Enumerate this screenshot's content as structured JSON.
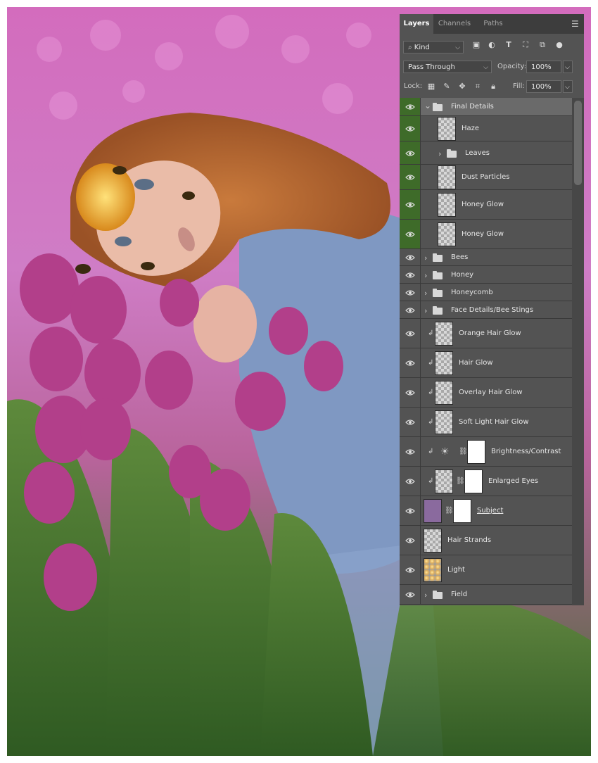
{
  "panel": {
    "tabs": [
      "Layers",
      "Channels",
      "Paths"
    ],
    "filter_kind": "Kind",
    "blend_mode": "Pass Through",
    "opacity_label": "Opacity:",
    "opacity_value": "100%",
    "lock_label": "Lock:",
    "fill_label": "Fill:",
    "fill_value": "100%"
  },
  "layers": [
    {
      "name": "Final Details",
      "kind": "group",
      "expanded": true,
      "selected": true,
      "green": true
    },
    {
      "name": "Haze",
      "kind": "pixel",
      "indent": true,
      "green": true
    },
    {
      "name": "Leaves",
      "kind": "group",
      "indent": true,
      "green": true
    },
    {
      "name": "Dust Particles",
      "kind": "pixel",
      "indent": true,
      "green": true
    },
    {
      "name": "Honey Glow",
      "kind": "pixel",
      "indent": true,
      "green": true
    },
    {
      "name": "Honey Glow",
      "kind": "pixel",
      "indent": true,
      "green": true
    },
    {
      "name": "Bees",
      "kind": "group"
    },
    {
      "name": "Honey",
      "kind": "group"
    },
    {
      "name": "Honeycomb",
      "kind": "group"
    },
    {
      "name": "Face Details/Bee Stings",
      "kind": "group"
    },
    {
      "name": "Orange Hair Glow",
      "kind": "pixel",
      "clipped": true
    },
    {
      "name": "Hair Glow",
      "kind": "pixel",
      "clipped": true
    },
    {
      "name": "Overlay Hair Glow",
      "kind": "pixel",
      "clipped": true
    },
    {
      "name": "Soft Light  Hair Glow",
      "kind": "pixel",
      "clipped": true
    },
    {
      "name": "Brightness/Contrast",
      "kind": "adjustment",
      "clipped": true
    },
    {
      "name": "Enlarged Eyes",
      "kind": "pixel-mask",
      "clipped": true
    },
    {
      "name": "Subject",
      "kind": "smart-mask"
    },
    {
      "name": "Hair Strands",
      "kind": "pixel"
    },
    {
      "name": "Light",
      "kind": "pixel"
    },
    {
      "name": "Field",
      "kind": "group"
    }
  ],
  "colors": {
    "panel_bg": "#535353",
    "visibility_green": "#3e6b29",
    "tulip_pink": "#b8408f",
    "background_field": "#d486c4"
  },
  "icons": [
    "eye-icon",
    "folder-icon",
    "chevron-right-icon",
    "chevron-down-icon",
    "clipping-arrow-icon",
    "link-chain-icon",
    "brightness-contrast-icon",
    "panel-menu-icon",
    "search-icon"
  ]
}
